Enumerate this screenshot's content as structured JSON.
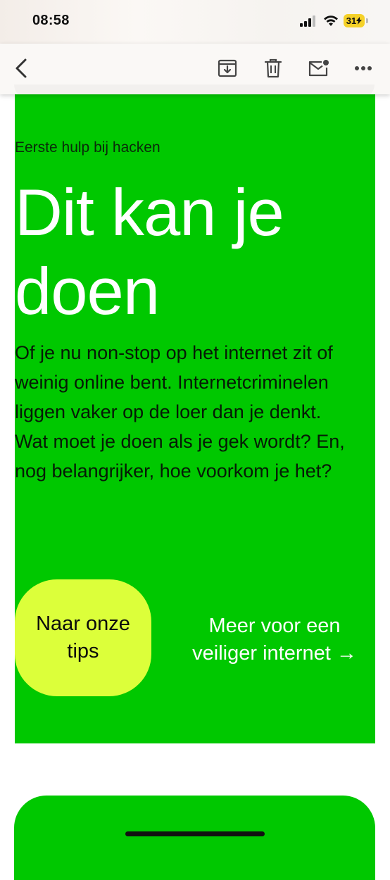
{
  "status_bar": {
    "time": "08:58",
    "battery": "31"
  },
  "toolbar": {
    "back_icon": "chevron-left-icon",
    "archive_icon": "archive-icon",
    "delete_icon": "trash-icon",
    "mark_unread_icon": "mail-unread-icon",
    "more_icon": "ellipsis-icon"
  },
  "email": {
    "eyebrow": "Eerste hulp bij hacken",
    "headline": "Dit kan je doen",
    "body": "Of je nu non-stop op het internet zit of weinig online bent. Internetcriminelen liggen vaker op de loer dan je denkt. Wat moet je doen als je gek wordt? En, nog belangrijker, hoe voorkom je het?",
    "cta_primary": "Naar onze tips",
    "cta_secondary": "Meer voor een veiliger internet →"
  },
  "colors": {
    "hero_green": "#00c800",
    "cta_yellow": "#dcff3a",
    "battery_yellow": "#f5d128"
  }
}
